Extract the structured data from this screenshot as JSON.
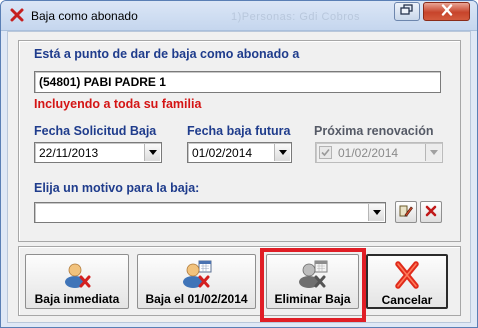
{
  "window": {
    "title": "Baja como abonado",
    "ghost_title": "1)Personas: Gdi Cobros"
  },
  "form": {
    "intro_label": "Está a punto de dar de baja como abonado a",
    "member_value": "(54801) PABI PADRE 1",
    "family_note": "Incluyendo a toda su familia",
    "fecha_solicitud": {
      "label": "Fecha Solicitud Baja",
      "value": "22/11/2013"
    },
    "fecha_futura": {
      "label": "Fecha baja futura",
      "value": "01/02/2014"
    },
    "proxima_renovacion": {
      "label": "Próxima renovación",
      "value": "01/02/2014",
      "enabled": false,
      "checked": true
    },
    "motivo": {
      "label": "Elija un motivo para la baja:",
      "value": ""
    }
  },
  "buttons": {
    "baja_inmediata": "Baja inmediata",
    "baja_fecha": "Baja el 01/02/2014",
    "eliminar_baja": "Eliminar Baja",
    "cancelar": "Cancelar"
  },
  "colors": {
    "label_blue": "#1f3c8c",
    "note_red": "#d41414",
    "highlight_red": "#e01e26"
  },
  "icons": {
    "title": "close-x-icon",
    "edit_motivo": "edit-pencil-icon",
    "clear_motivo": "delete-x-icon",
    "baja_inmediata": "user-remove-icon",
    "baja_fecha": "user-calendar-remove-icon",
    "eliminar_baja": "user-grey-calendar-icon",
    "cancelar": "cancel-x-icon"
  }
}
